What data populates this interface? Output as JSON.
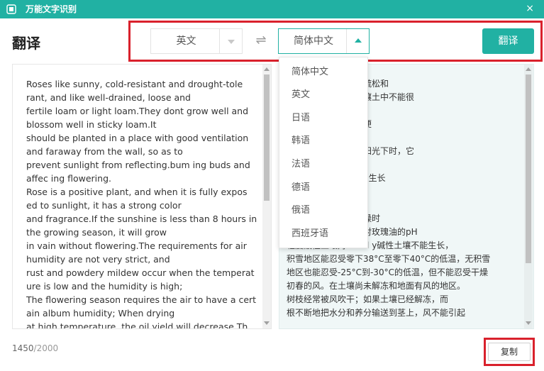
{
  "window": {
    "title": "万能文字识别",
    "close": "×"
  },
  "page": {
    "title": "翻译"
  },
  "source_lang": {
    "value": "英文"
  },
  "target_lang": {
    "value": "简体中文"
  },
  "swap_icon": "⇌",
  "translate_label": "翻译",
  "dropdown": {
    "options": [
      "简体中文",
      "英文",
      "日语",
      "韩语",
      "法语",
      "德语",
      "俄语",
      "西班牙语"
    ]
  },
  "source_text": [
    "Roses like sunny,  cold-resistant and drought-tole",
    "rant,  and like well-drained,  loose and",
    "fertile loam or light loam.They dont grow well and",
    " blossom well in sticky loam.It",
    "should be planted in a place with good ventilation",
    " and faraway from the wall,  so as to",
    "prevent sunlight from reflecting.bum ing buds and",
    " affec ing flowering.",
    "Rose is a positive plant,  and when it is fully expos",
    "ed to sunlight,  it has a strong color",
    "and fragrance.If the sunshine is less than 8 hours in",
    "the growing season,  it will grow",
    "in vain without flowering.The requirements for air",
    " humidity are not very strict,  and",
    "rust and powdery mildew occur when the temperat",
    "ure is low and the humidity is high;",
    "The flowering season requires the air to have a cert",
    "ain album humidity;  When drying",
    "at high temperature,  the oil yield will decrease.Th"
  ],
  "translated_text": [
    "                                    耐旱，喜排水良好、疏松和",
    "                                    壤土。它们在粘稠的壤土中不能很",
    "",
    "                                    远离墙壁的地方，以便",
    "                                    蕾开花。",
    "                                    物，当它充分暴露在阳光下时，它",
    "",
    "                                    照少于8小时，它就会生长",
    "                                    是很严格，而且",
    "                                    生锈病，白粉病；",
    "                                    一定的相册湿度；干燥时",
    "                                    油的出油率会下降，对玫瑰油的pH",
    "轻度酸性土壤对sli htl y碱性土壤不能生长，",
    "积雪地区能忍受零下38°C至零下40°C的低温，无积雪",
    "地区也能忍受-25°C到-30°C的低温，但不能忍受干燥",
    "初春的风。在土壤尚未解冻和地面有风的地区。",
    "树枝经常被风吹干；如果土壤已经解冻，而",
    "根不断地把水分和养分输送到茎上，风不能引起"
  ],
  "char_count": {
    "current": "1450",
    "max": "/2000"
  },
  "copy_label": "复制",
  "colors": {
    "accent": "#21b1a3",
    "highlight": "#d9212c",
    "result_bg": "#f0f7f7"
  }
}
